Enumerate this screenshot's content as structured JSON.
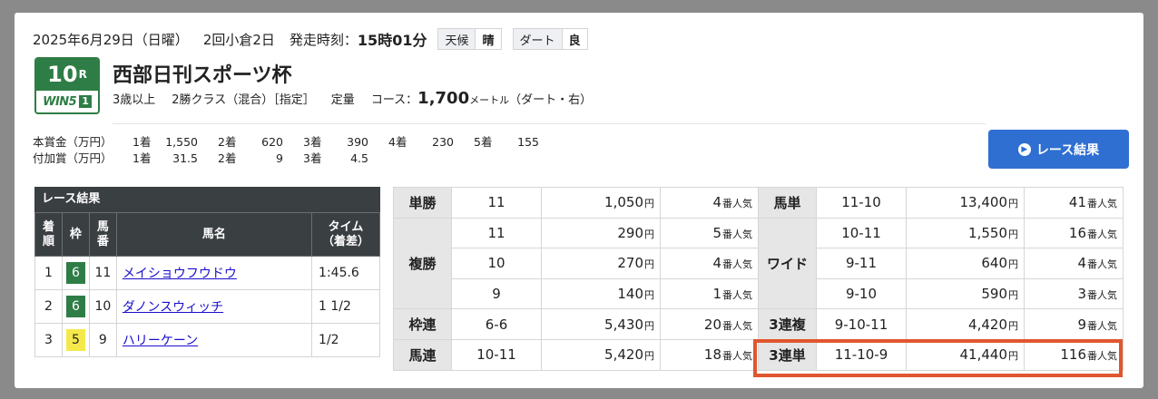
{
  "header": {
    "date": "2025年6月29日（日曜）",
    "meeting": "2回小倉2日",
    "post_time_label": "発走時刻：",
    "post_time": "15時01分",
    "weather_label": "天候",
    "weather": "晴",
    "track_label": "ダート",
    "track_condition": "良"
  },
  "race": {
    "number": "10",
    "number_suffix": "R",
    "win5_text": "WIN5",
    "win5_leg": "1",
    "name": "西部日刊スポーツ杯",
    "age": "3歳以上",
    "class": "2勝クラス（混合）［指定］",
    "weight_rule": "定量",
    "course_label": "コース：",
    "distance": "1,700",
    "distance_unit": "メートル",
    "course_detail": "（ダート・右）"
  },
  "prize": {
    "rows": [
      {
        "label": "本賞金（万円）",
        "items": [
          [
            "1着",
            "1,550"
          ],
          [
            "2着",
            "620"
          ],
          [
            "3着",
            "390"
          ],
          [
            "4着",
            "230"
          ],
          [
            "5着",
            "155"
          ]
        ]
      },
      {
        "label": "付加賞（万円）",
        "items": [
          [
            "1着",
            "31.5"
          ],
          [
            "2着",
            "9"
          ],
          [
            "3着",
            "4.5"
          ]
        ]
      }
    ]
  },
  "result_button": {
    "label": "レース結果",
    "icon": "chevron-right-circle-icon"
  },
  "results": {
    "title": "レース結果",
    "headers": {
      "rank": "着順",
      "frame": "枠",
      "horse_no": "馬番",
      "name": "馬名",
      "time": "タイム（着差）"
    },
    "rows": [
      {
        "rank": "1",
        "frame": "6",
        "frame_bg": "#2e7d46",
        "frame_fg": "#ffffff",
        "horse_no": "11",
        "name": "メイショウフウドウ",
        "time": "1:45.6"
      },
      {
        "rank": "2",
        "frame": "6",
        "frame_bg": "#2e7d46",
        "frame_fg": "#ffffff",
        "horse_no": "10",
        "name": "ダノンスウィッチ",
        "time": "1 1/2"
      },
      {
        "rank": "3",
        "frame": "5",
        "frame_bg": "#f5e84a",
        "frame_fg": "#222222",
        "horse_no": "9",
        "name": "ハリーケーン",
        "time": "1/2"
      }
    ]
  },
  "payouts": {
    "yen": "円",
    "pop_suffix": "番人気",
    "left": {
      "tansho": {
        "label": "単勝",
        "combo": "11",
        "payout": "1,050",
        "pop": "4"
      },
      "fukusho": {
        "label": "複勝",
        "rows": [
          {
            "combo": "11",
            "payout": "290",
            "pop": "5"
          },
          {
            "combo": "10",
            "payout": "270",
            "pop": "4"
          },
          {
            "combo": "9",
            "payout": "140",
            "pop": "1"
          }
        ]
      },
      "wakuren": {
        "label": "枠連",
        "combo": "6-6",
        "payout": "5,430",
        "pop": "20"
      },
      "umaren": {
        "label": "馬連",
        "combo": "10-11",
        "payout": "5,420",
        "pop": "18"
      }
    },
    "right": {
      "umatan": {
        "label": "馬単",
        "combo": "11-10",
        "payout": "13,400",
        "pop": "41"
      },
      "wide": {
        "label": "ワイド",
        "rows": [
          {
            "combo": "10-11",
            "payout": "1,550",
            "pop": "16"
          },
          {
            "combo": "9-11",
            "payout": "640",
            "pop": "4"
          },
          {
            "combo": "9-10",
            "payout": "590",
            "pop": "3"
          }
        ]
      },
      "sanrenpuku": {
        "label": "3連複",
        "combo": "9-10-11",
        "payout": "4,420",
        "pop": "9"
      },
      "sanrentan": {
        "label": "3連単",
        "combo": "11-10-9",
        "payout": "41,440",
        "pop": "116"
      }
    }
  },
  "highlight_color": "#e0562f"
}
